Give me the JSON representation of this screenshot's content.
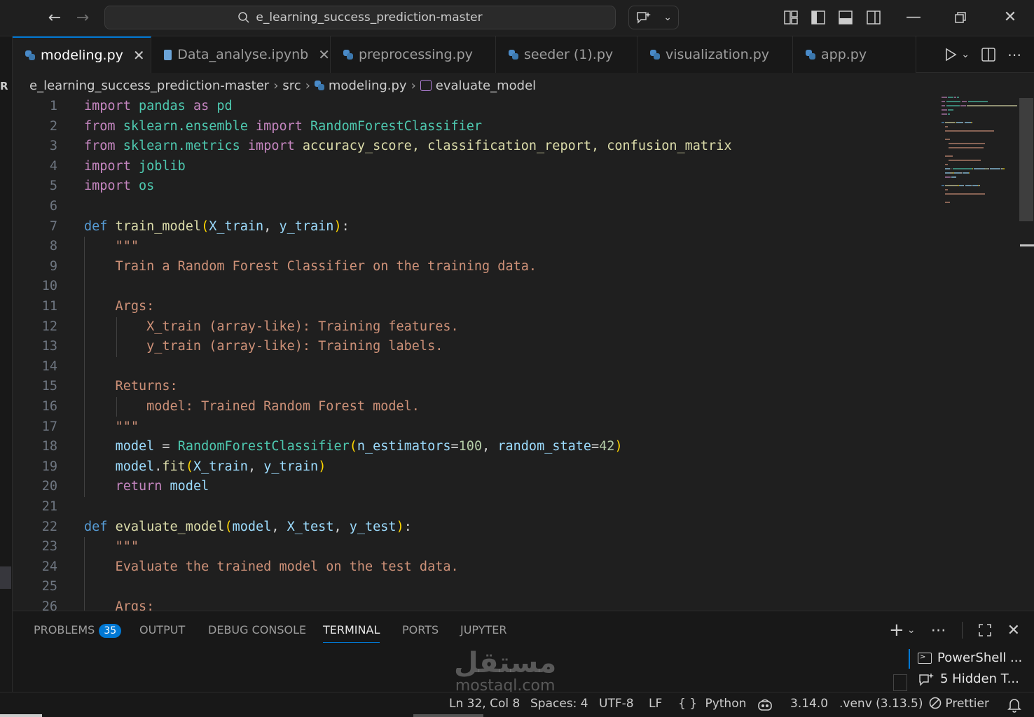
{
  "titlebar": {
    "search_text": "e_learning_success_prediction-master"
  },
  "tabs": [
    {
      "label": "modeling.py",
      "active": true,
      "icon": "python-icon"
    },
    {
      "label": "Data_analyse.ipynb",
      "active": false,
      "icon": "notebook-icon"
    },
    {
      "label": "preprocessing.py",
      "active": false,
      "icon": "python-icon"
    },
    {
      "label": "seeder (1).py",
      "active": false,
      "icon": "python-icon"
    },
    {
      "label": "visualization.py",
      "active": false,
      "icon": "python-icon"
    },
    {
      "label": "app.py",
      "active": false,
      "icon": "python-icon"
    }
  ],
  "sidebar_letter": "R",
  "breadcrumb": {
    "root": "e_learning_success_prediction-master",
    "folder": "src",
    "file": "modeling.py",
    "symbol": "evaluate_model"
  },
  "colors": {
    "keyword_import": "#c586c0",
    "keyword_def": "#569cd6",
    "function": "#dcdcaa",
    "class": "#4ec9b0",
    "variable": "#9cdcfe",
    "string": "#ce9178",
    "number": "#b5cea8",
    "accent": "#0078d4"
  },
  "editor": {
    "lines": [
      {
        "n": "1",
        "t": [
          [
            "import",
            "k"
          ],
          [
            " pandas ",
            "cl"
          ],
          [
            "as",
            "k"
          ],
          [
            " pd",
            "cl"
          ]
        ]
      },
      {
        "n": "2",
        "t": [
          [
            "from",
            "k"
          ],
          [
            " sklearn.ensemble ",
            "cl"
          ],
          [
            "import",
            "k"
          ],
          [
            " RandomForestClassifier",
            "cl"
          ]
        ]
      },
      {
        "n": "3",
        "t": [
          [
            "from",
            "k"
          ],
          [
            " sklearn.metrics ",
            "cl"
          ],
          [
            "import",
            "k"
          ],
          [
            " accuracy_score, classification_report, confusion_matrix",
            "fn"
          ]
        ]
      },
      {
        "n": "4",
        "t": [
          [
            "import",
            "k"
          ],
          [
            " joblib",
            "cl"
          ]
        ]
      },
      {
        "n": "5",
        "t": [
          [
            "import",
            "k"
          ],
          [
            " os",
            "cl"
          ]
        ]
      },
      {
        "n": "6",
        "t": []
      },
      {
        "n": "7",
        "t": [
          [
            "def",
            "kw"
          ],
          [
            " ",
            "p"
          ],
          [
            "train_model",
            "fn"
          ],
          [
            "(",
            "br1"
          ],
          [
            "X_train",
            "v"
          ],
          [
            ", ",
            "p"
          ],
          [
            "y_train",
            "v"
          ],
          [
            ")",
            "br1"
          ],
          [
            ":",
            "p"
          ]
        ]
      },
      {
        "n": "8",
        "t": [
          [
            "    \"\"\"",
            "s"
          ]
        ]
      },
      {
        "n": "9",
        "t": [
          [
            "    Train a Random Forest Classifier on the training data.",
            "s"
          ]
        ]
      },
      {
        "n": "10",
        "t": []
      },
      {
        "n": "11",
        "t": [
          [
            "    Args:",
            "s"
          ]
        ]
      },
      {
        "n": "12",
        "t": [
          [
            "        X_train (array-like): Training features.",
            "s"
          ]
        ]
      },
      {
        "n": "13",
        "t": [
          [
            "        y_train (array-like): Training labels.",
            "s"
          ]
        ]
      },
      {
        "n": "14",
        "t": []
      },
      {
        "n": "15",
        "t": [
          [
            "    Returns:",
            "s"
          ]
        ]
      },
      {
        "n": "16",
        "t": [
          [
            "        model: Trained Random Forest model.",
            "s"
          ]
        ]
      },
      {
        "n": "17",
        "t": [
          [
            "    \"\"\"",
            "s"
          ]
        ]
      },
      {
        "n": "18",
        "t": [
          [
            "    ",
            "p"
          ],
          [
            "model",
            "v"
          ],
          [
            " = ",
            "p"
          ],
          [
            "RandomForestClassifier",
            "cl"
          ],
          [
            "(",
            "br1"
          ],
          [
            "n_estimators",
            "v"
          ],
          [
            "=",
            "p"
          ],
          [
            "100",
            "n"
          ],
          [
            ", ",
            "p"
          ],
          [
            "random_state",
            "v"
          ],
          [
            "=",
            "p"
          ],
          [
            "42",
            "n"
          ],
          [
            ")",
            "br1"
          ]
        ]
      },
      {
        "n": "19",
        "t": [
          [
            "    ",
            "p"
          ],
          [
            "model",
            "v"
          ],
          [
            ".",
            "p"
          ],
          [
            "fit",
            "fn"
          ],
          [
            "(",
            "br1"
          ],
          [
            "X_train",
            "v"
          ],
          [
            ", ",
            "p"
          ],
          [
            "y_train",
            "v"
          ],
          [
            ")",
            "br1"
          ]
        ]
      },
      {
        "n": "20",
        "t": [
          [
            "    ",
            "p"
          ],
          [
            "return",
            "k"
          ],
          [
            " ",
            "p"
          ],
          [
            "model",
            "v"
          ]
        ]
      },
      {
        "n": "21",
        "t": []
      },
      {
        "n": "22",
        "t": [
          [
            "def",
            "kw"
          ],
          [
            " ",
            "p"
          ],
          [
            "evaluate_model",
            "fn"
          ],
          [
            "(",
            "br1"
          ],
          [
            "model",
            "v"
          ],
          [
            ", ",
            "p"
          ],
          [
            "X_test",
            "v"
          ],
          [
            ", ",
            "p"
          ],
          [
            "y_test",
            "v"
          ],
          [
            ")",
            "br1"
          ],
          [
            ":",
            "p"
          ]
        ]
      },
      {
        "n": "23",
        "t": [
          [
            "    \"\"\"",
            "s"
          ]
        ]
      },
      {
        "n": "24",
        "t": [
          [
            "    Evaluate the trained model on the test data.",
            "s"
          ]
        ]
      },
      {
        "n": "25",
        "t": []
      },
      {
        "n": "26",
        "t": [
          [
            "    Args:",
            "s"
          ]
        ]
      }
    ]
  },
  "panel": {
    "tabs": [
      {
        "label": "PROBLEMS",
        "badge": "35"
      },
      {
        "label": "OUTPUT"
      },
      {
        "label": "DEBUG CONSOLE"
      },
      {
        "label": "TERMINAL",
        "active": true
      },
      {
        "label": "PORTS"
      },
      {
        "label": "JUPYTER"
      }
    ],
    "terminals": [
      {
        "label": "PowerShell ..."
      },
      {
        "label": "5 Hidden T..."
      }
    ],
    "watermark_ar": "مستقل",
    "watermark_en": "mostaql.com"
  },
  "statusbar": {
    "position": "Ln 32, Col 8",
    "spaces": "Spaces: 4",
    "encoding": "UTF-8",
    "eol": "LF",
    "language_braces": "{ }",
    "language": "Python",
    "python_version": "3.14.0",
    "venv": ".venv (3.13.5)",
    "formatter": "Prettier"
  }
}
